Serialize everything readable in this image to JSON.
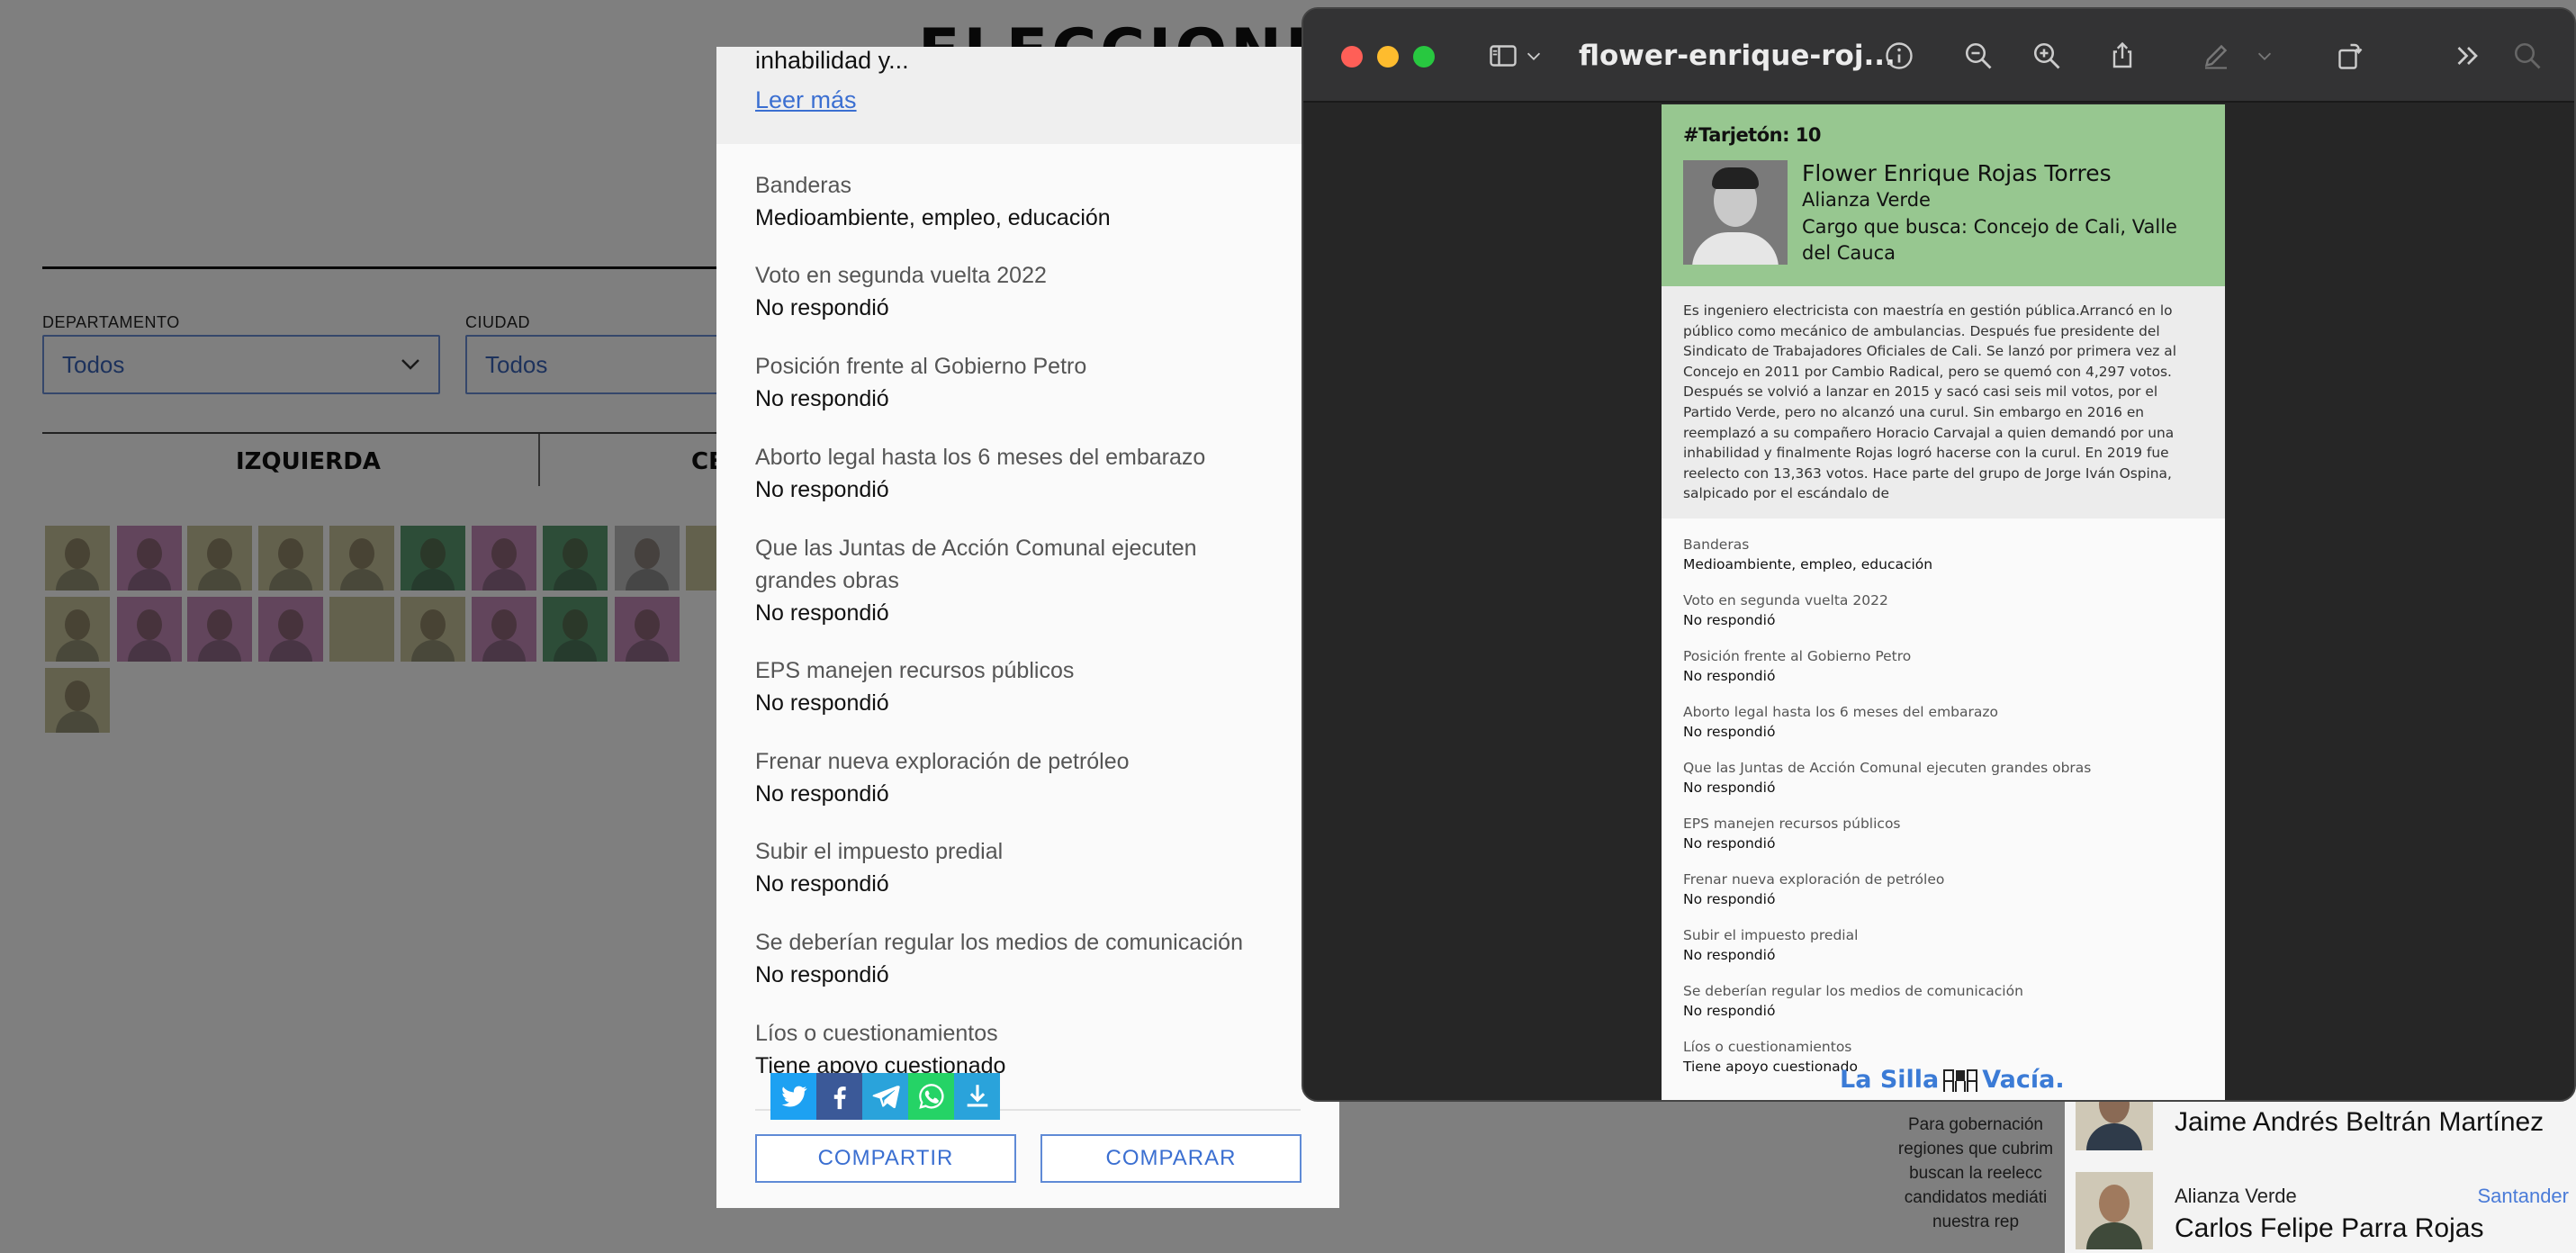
{
  "background_page": {
    "title_partial": "ELECCIONES REG",
    "filters": {
      "departamento_label": "DEPARTAMENTO",
      "departamento_value": "Todos",
      "ciudad_label": "CIUDAD",
      "ciudad_value": "Todos"
    },
    "tabs": [
      "IZQUIERDA",
      "CE"
    ],
    "side_note": "Para gobernación regiones que cubrim buscan la reelecc candidatos mediáti nuestra rep"
  },
  "candidate_list": [
    {
      "party": "",
      "department": "",
      "name": "Jaime Andrés Beltrán Martínez"
    },
    {
      "party": "Alianza Verde",
      "department": "Santander",
      "name": "Carlos Felipe Parra Rojas"
    }
  ],
  "modal": {
    "bio_tail": "inhabilidad y...",
    "read_more": "Leer más",
    "qa": [
      {
        "q": "Banderas",
        "a": "Medioambiente, empleo, educación"
      },
      {
        "q": "Voto en segunda vuelta 2022",
        "a": "No respondió"
      },
      {
        "q": "Posición frente al Gobierno Petro",
        "a": "No respondió"
      },
      {
        "q": "Aborto legal hasta los 6 meses del embarazo",
        "a": "No respondió"
      },
      {
        "q": "Que las Juntas de Acción Comunal ejecuten grandes obras",
        "a": "No respondió"
      },
      {
        "q": "EPS manejen recursos públicos",
        "a": "No respondió"
      },
      {
        "q": "Frenar nueva exploración de petróleo",
        "a": "No respondió"
      },
      {
        "q": "Subir el impuesto predial",
        "a": "No respondió"
      },
      {
        "q": "Se deberían regular los medios de comunicación",
        "a": "No respondió"
      },
      {
        "q": "Líos o cuestionamientos",
        "a": "Tiene apoyo cuestionado"
      }
    ],
    "share_icons": [
      "twitter-icon",
      "facebook-icon",
      "telegram-icon",
      "whatsapp-icon",
      "download-icon"
    ],
    "share_colors": [
      "#1da1f2",
      "#3b5998",
      "#2aa3db",
      "#25d366",
      "#2aa3db"
    ],
    "buttons": {
      "share": "COMPARTIR",
      "compare": "COMPARAR"
    }
  },
  "preview_window": {
    "title": "flower-enrique-roj...",
    "toolbar_icons": [
      "sidebar-icon",
      "chevron-down-icon",
      "info-icon",
      "zoom-out-icon",
      "zoom-in-icon",
      "share-icon",
      "markup-pen-icon",
      "chevron-down-icon",
      "rotate-icon",
      "more-chevrons-icon",
      "search-icon"
    ],
    "document": {
      "tarjeton": "#Tarjetón: 10",
      "name": "Flower Enrique Rojas Torres",
      "party": "Alianza Verde",
      "cargo": "Cargo que busca: Concejo de Cali, Valle del Cauca",
      "bio": "Es ingeniero electricista con maestría en gestión pública.Arrancó en lo público como mecánico de ambulancias. Después fue presidente del Sindicato de Trabajadores Oficiales de Cali. Se lanzó por primera vez al Concejo en 2011 por Cambio Radical, pero se quemó con 4,297 votos. Después se volvió a lanzar en 2015 y sacó casi seis mil votos, por el Partido Verde, pero no alcanzó una curul. Sin embargo en 2016 en reemplazó a su compañero Horacio Carvajal a quien demandó por una inhabilidad y finalmente Rojas logró hacerse con la curul. En 2019 fue reelecto con 13,363 votos. Hace parte del grupo de Jorge Iván Ospina, salpicado por el escándalo de",
      "qa": [
        {
          "q": "Banderas",
          "a": "Medioambiente, empleo, educación"
        },
        {
          "q": "Voto en segunda vuelta 2022",
          "a": "No respondió"
        },
        {
          "q": "Posición frente al Gobierno Petro",
          "a": "No respondió"
        },
        {
          "q": "Aborto legal hasta los 6 meses del embarazo",
          "a": "No respondió"
        },
        {
          "q": "Que las Juntas de Acción Comunal ejecuten grandes obras",
          "a": "No respondió"
        },
        {
          "q": "EPS manejen recursos públicos",
          "a": "No respondió"
        },
        {
          "q": "Frenar nueva exploración de petróleo",
          "a": "No respondió"
        },
        {
          "q": "Subir el impuesto predial",
          "a": "No respondió"
        },
        {
          "q": "Se deberían regular los medios de comunicación",
          "a": "No respondió"
        },
        {
          "q": "Líos o cuestionamientos",
          "a": "Tiene apoyo cuestionado"
        }
      ],
      "logo_left": "La Silla",
      "logo_right": "Vacía."
    }
  },
  "colors": {
    "header_green": "#97c790",
    "link_blue": "#3b6fd1",
    "traffic_red": "#ff5f57",
    "traffic_yellow": "#febc2e",
    "traffic_green": "#28c840"
  }
}
